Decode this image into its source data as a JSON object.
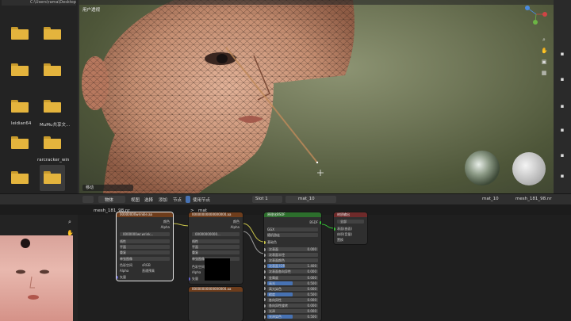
{
  "file_browser": {
    "path": "C:\\Users\\rama\\Desktop\\Un...",
    "items": [
      {
        "label": ""
      },
      {
        "label": ""
      },
      {
        "label": ""
      },
      {
        "label": ""
      },
      {
        "label": "leidian64"
      },
      {
        "label": "MuMu共享文..."
      },
      {
        "label": ""
      },
      {
        "label": "rarcracker_win"
      },
      {
        "label": ""
      },
      {
        "label": ""
      }
    ],
    "folder_color": "#e4b43d"
  },
  "viewport": {
    "mode_label": "用户透视",
    "status_label": "移动",
    "bg_color": "#6f7657",
    "right_icons": [
      "zoom-icon",
      "hand-icon",
      "camera-icon",
      "grid-icon"
    ]
  },
  "node_editor_header": {
    "editor_icon": "node-editor-icon",
    "object_mode": "物体",
    "menu_view": "视图",
    "menu_select": "选择",
    "menu_add": "添加",
    "menu_node": "节点",
    "use_nodes_label": "使用节点",
    "slot_label": "Slot 1",
    "material_name": "mat_10",
    "right_material": "mat_10",
    "right_object": "mesh_181_98.nr"
  },
  "breadcrumb": {
    "object": "mesh_181_98.nr",
    "separator": ">",
    "material": "mat"
  },
  "nodes": {
    "image_texture_1": {
      "title": "00000000wrinkle.aa",
      "out_color": "颜色",
      "out_alpha": "Alpha",
      "image_name": "0000000wr.wrink...",
      "interp": "线性",
      "projection": "平面",
      "extension": "重复",
      "source": "单张图像",
      "color_space": "色彩空间",
      "color_space_val": "sRGB",
      "alpha_label": "Alpha",
      "alpha_val": "直通预乘",
      "vector": "矢量"
    },
    "image_texture_2": {
      "title": "00000000000000000.aa",
      "out_color": "颜色",
      "out_alpha": "Alpha",
      "image_name": "00000000000...",
      "interp": "线性",
      "projection": "平面",
      "extension": "重复",
      "source": "单张图像",
      "color_space": "色彩空间",
      "alpha_label": "Alpha",
      "vector": "矢量"
    },
    "image_texture_3": {
      "title": "00000000000000000.aa"
    },
    "principled": {
      "title": "原理化BSDF",
      "out_bsdf": "BSDF",
      "distribution": "GGX",
      "subsurface_method": "随机游走",
      "base_color": "基础色",
      "rows": [
        {
          "label": "次表面",
          "value": "0.000",
          "fill": 0.0
        },
        {
          "label": "次表面半径",
          "value": "",
          "fill": 0.0
        },
        {
          "label": "次表面颜色",
          "value": "",
          "fill": 0.0
        },
        {
          "label": "次表面 IOR",
          "value": "1.400",
          "fill": 0.35
        },
        {
          "label": "次表面各向异性",
          "value": "0.000",
          "fill": 0.0
        },
        {
          "label": "金属度",
          "value": "0.000",
          "fill": 0.0
        },
        {
          "label": "高光",
          "value": "0.500",
          "fill": 0.5
        },
        {
          "label": "高光染色",
          "value": "0.000",
          "fill": 0.0
        },
        {
          "label": "糙度",
          "value": "0.500",
          "fill": 0.5
        },
        {
          "label": "各向异性",
          "value": "0.000",
          "fill": 0.0
        },
        {
          "label": "各向异性旋转",
          "value": "0.000",
          "fill": 0.0
        },
        {
          "label": "光泽",
          "value": "0.000",
          "fill": 0.0
        },
        {
          "label": "光泽染色",
          "value": "0.500",
          "fill": 0.5
        }
      ]
    },
    "material_output": {
      "title": "材质输出",
      "target": "全部",
      "in_surface": "表面(曲面)",
      "in_volume": "体积(音量)",
      "in_displacement": "置换"
    }
  },
  "colors": {
    "texture_header": "#6e3d1c",
    "shader_header": "#2c6e2c",
    "output_header": "#6e2a2a",
    "link_color": "#c8c34a",
    "accent_blue": "#4772b3"
  }
}
